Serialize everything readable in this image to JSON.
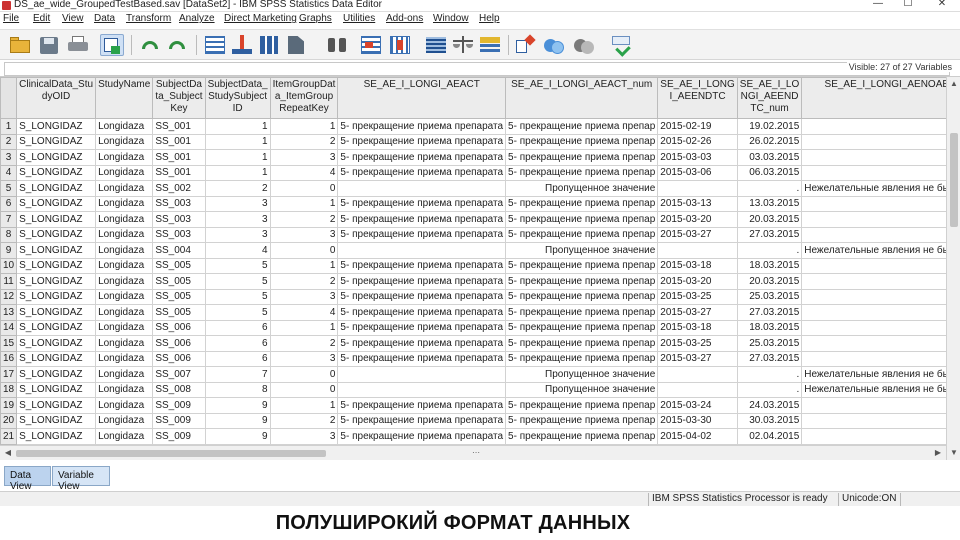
{
  "window": {
    "title": "DS_ae_wide_GroupedTestBased.sav [DataSet2] - IBM SPSS Statistics Data Editor",
    "controls": {
      "minimize": "—",
      "maximize": "☐",
      "close": "✕"
    }
  },
  "menu": [
    "File",
    "Edit",
    "View",
    "Data",
    "Transform",
    "Analyze",
    "Direct Marketing",
    "Graphs",
    "Utilities",
    "Add-ons",
    "Window",
    "Help"
  ],
  "toolbar_icons": [
    "open-icon",
    "save-icon",
    "print-icon",
    "recall-dialog-icon",
    "undo-icon",
    "redo-icon",
    "goto-case-icon",
    "goto-variable-icon",
    "variables-icon",
    "run-descriptives-icon",
    "find-icon",
    "insert-cases-icon",
    "insert-variable-icon",
    "split-file-icon",
    "weight-cases-icon",
    "select-cases-icon",
    "value-labels-icon",
    "use-sets-icon",
    "show-all-variables-icon",
    "spell-check-icon"
  ],
  "colors": {
    "header_bg": "#ececec",
    "tab_active": "#bcd3ee",
    "tab_inactive": "#d6e5f6",
    "grid_line": "#d2d2d2"
  },
  "variables_visible": "Visible: 27 of 27 Variables",
  "columns": [
    "ClinicalData_StudyOID",
    "StudyName",
    "SubjectData_SubjectKey",
    "SubjectData_StudySubjectID",
    "ItemGroupData_ItemGroupRepeatKey",
    "SE_AE_I_LONGI_AEACT",
    "SE_AE_I_LONGI_AEACT_num",
    "SE_AE_I_LONGI_AEENDTC",
    "SE_AE_I_LONGI_AEENDTC_num",
    "SE_AE_I_LONGI_AENOAE"
  ],
  "header_labels": [
    "ClinicalData_Stu dyOID",
    "StudyName",
    "SubjectDa ta_Subject Key",
    "SubjectData_ StudySubject ID",
    "ItemGroupDat a_ItemGroup RepeatKey",
    "SE_AE_I_LONGI_AEACT",
    "SE_AE_I_LONGI_AEACT_num",
    "SE_AE_I_LONG I_AEENDTC",
    "SE_AE_I_LO NGI_AEEND TC_num",
    "SE_AE_I_LONGI_AENOAE"
  ],
  "rows": [
    [
      "1",
      "S_LONGIDAZ",
      "Longidaza",
      "SS_001",
      "1",
      "1",
      "5- прекращение приема препарата",
      "5- прекращение приема препар",
      "2015-02-19",
      "19.02.2015",
      ""
    ],
    [
      "2",
      "S_LONGIDAZ",
      "Longidaza",
      "SS_001",
      "1",
      "2",
      "5- прекращение приема препарата",
      "5- прекращение приема препар",
      "2015-02-26",
      "26.02.2015",
      ""
    ],
    [
      "3",
      "S_LONGIDAZ",
      "Longidaza",
      "SS_001",
      "1",
      "3",
      "5- прекращение приема препарата",
      "5- прекращение приема препар",
      "2015-03-03",
      "03.03.2015",
      ""
    ],
    [
      "4",
      "S_LONGIDAZ",
      "Longidaza",
      "SS_001",
      "1",
      "4",
      "5- прекращение приема препарата",
      "5- прекращение приема препар",
      "2015-03-06",
      "06.03.2015",
      ""
    ],
    [
      "5",
      "S_LONGIDAZ",
      "Longidaza",
      "SS_002",
      "2",
      "0",
      "",
      "Пропущенное значение",
      "",
      ".",
      "Нежелательные явления не были в"
    ],
    [
      "6",
      "S_LONGIDAZ",
      "Longidaza",
      "SS_003",
      "3",
      "1",
      "5- прекращение приема препарата",
      "5- прекращение приема препар",
      "2015-03-13",
      "13.03.2015",
      ""
    ],
    [
      "7",
      "S_LONGIDAZ",
      "Longidaza",
      "SS_003",
      "3",
      "2",
      "5- прекращение приема препарата",
      "5- прекращение приема препар",
      "2015-03-20",
      "20.03.2015",
      ""
    ],
    [
      "8",
      "S_LONGIDAZ",
      "Longidaza",
      "SS_003",
      "3",
      "3",
      "5- прекращение приема препарата",
      "5- прекращение приема препар",
      "2015-03-27",
      "27.03.2015",
      ""
    ],
    [
      "9",
      "S_LONGIDAZ",
      "Longidaza",
      "SS_004",
      "4",
      "0",
      "",
      "Пропущенное значение",
      "",
      ".",
      "Нежелательные явления не были в"
    ],
    [
      "10",
      "S_LONGIDAZ",
      "Longidaza",
      "SS_005",
      "5",
      "1",
      "5- прекращение приема препарата",
      "5- прекращение приема препар",
      "2015-03-18",
      "18.03.2015",
      ""
    ],
    [
      "11",
      "S_LONGIDAZ",
      "Longidaza",
      "SS_005",
      "5",
      "2",
      "5- прекращение приема препарата",
      "5- прекращение приема препар",
      "2015-03-20",
      "20.03.2015",
      ""
    ],
    [
      "12",
      "S_LONGIDAZ",
      "Longidaza",
      "SS_005",
      "5",
      "3",
      "5- прекращение приема препарата",
      "5- прекращение приема препар",
      "2015-03-25",
      "25.03.2015",
      ""
    ],
    [
      "13",
      "S_LONGIDAZ",
      "Longidaza",
      "SS_005",
      "5",
      "4",
      "5- прекращение приема препарата",
      "5- прекращение приема препар",
      "2015-03-27",
      "27.03.2015",
      ""
    ],
    [
      "14",
      "S_LONGIDAZ",
      "Longidaza",
      "SS_006",
      "6",
      "1",
      "5- прекращение приема препарата",
      "5- прекращение приема препар",
      "2015-03-18",
      "18.03.2015",
      ""
    ],
    [
      "15",
      "S_LONGIDAZ",
      "Longidaza",
      "SS_006",
      "6",
      "2",
      "5- прекращение приема препарата",
      "5- прекращение приема препар",
      "2015-03-25",
      "25.03.2015",
      ""
    ],
    [
      "16",
      "S_LONGIDAZ",
      "Longidaza",
      "SS_006",
      "6",
      "3",
      "5- прекращение приема препарата",
      "5- прекращение приема препар",
      "2015-03-27",
      "27.03.2015",
      ""
    ],
    [
      "17",
      "S_LONGIDAZ",
      "Longidaza",
      "SS_007",
      "7",
      "0",
      "",
      "Пропущенное значение",
      "",
      ".",
      "Нежелательные явления не были в"
    ],
    [
      "18",
      "S_LONGIDAZ",
      "Longidaza",
      "SS_008",
      "8",
      "0",
      "",
      "Пропущенное значение",
      "",
      ".",
      "Нежелательные явления не были в"
    ],
    [
      "19",
      "S_LONGIDAZ",
      "Longidaza",
      "SS_009",
      "9",
      "1",
      "5- прекращение приема препарата",
      "5- прекращение приема препар",
      "2015-03-24",
      "24.03.2015",
      ""
    ],
    [
      "20",
      "S_LONGIDAZ",
      "Longidaza",
      "SS_009",
      "9",
      "2",
      "5- прекращение приема препарата",
      "5- прекращение приема препар",
      "2015-03-30",
      "30.03.2015",
      ""
    ],
    [
      "21",
      "S_LONGIDAZ",
      "Longidaza",
      "SS_009",
      "9",
      "3",
      "5- прекращение приема препарата",
      "5- прекращение приема препар",
      "2015-04-02",
      "02.04.2015",
      ""
    ]
  ],
  "tabs": {
    "data_view": "Data View",
    "variable_view": "Variable View"
  },
  "status": {
    "processor": "IBM SPSS Statistics Processor is ready",
    "unicode": "Unicode:ON"
  },
  "caption": "ПОЛУШИРОКИЙ ФОРМАТ ДАННЫХ"
}
